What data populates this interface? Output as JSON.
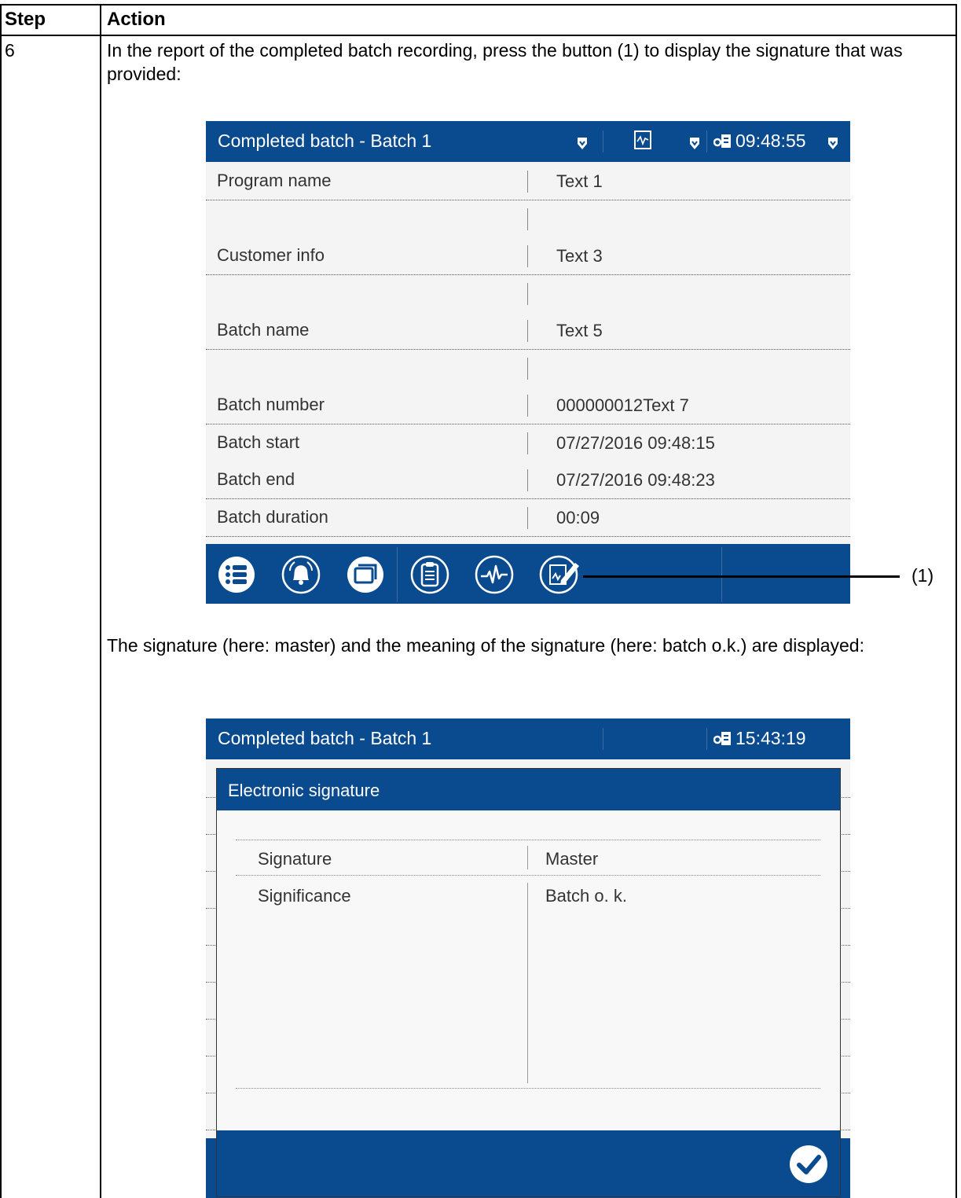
{
  "table": {
    "col_step": "Step",
    "col_action": "Action",
    "step_number": "6",
    "instruction_1": "In the report of the completed batch recording, press the button (1) to display the signature that was provided:",
    "instruction_2": "The signature (here: master) and the meaning of the signature (here: batch o.k.) are displayed:",
    "callout_label": "(1)"
  },
  "screen1": {
    "title": "Completed batch - Batch 1",
    "time": "09:48:55",
    "rows": [
      {
        "label": "Program name",
        "value": "Text 1"
      },
      {
        "label": "",
        "value": ""
      },
      {
        "label": "Customer info",
        "value": "Text 3"
      },
      {
        "label": "",
        "value": ""
      },
      {
        "label": "Batch name",
        "value": "Text 5"
      },
      {
        "label": "",
        "value": ""
      },
      {
        "label": "Batch number",
        "value": "000000012Text 7"
      },
      {
        "label": "Batch start",
        "value": "07/27/2016 09:48:15"
      },
      {
        "label": "Batch end",
        "value": "07/27/2016 09:48:23"
      },
      {
        "label": "Batch duration",
        "value": "00:09"
      }
    ],
    "toolbar_icons": [
      "menu-icon",
      "alarm-bell-icon",
      "windows-icon",
      "report-clipboard-icon",
      "curve-icon",
      "signature-icon"
    ]
  },
  "screen2": {
    "title": "Completed batch - Batch 1",
    "time": "15:43:19",
    "dialog": {
      "title": "Electronic signature",
      "rows": [
        {
          "label": "Signature",
          "value": "Master"
        },
        {
          "label": "Significance",
          "value": "Batch o. k."
        }
      ],
      "confirm_icon": "checkmark-icon"
    }
  },
  "colors": {
    "device_blue": "#0a4a8f",
    "screen_bg": "#f4f4f4"
  }
}
